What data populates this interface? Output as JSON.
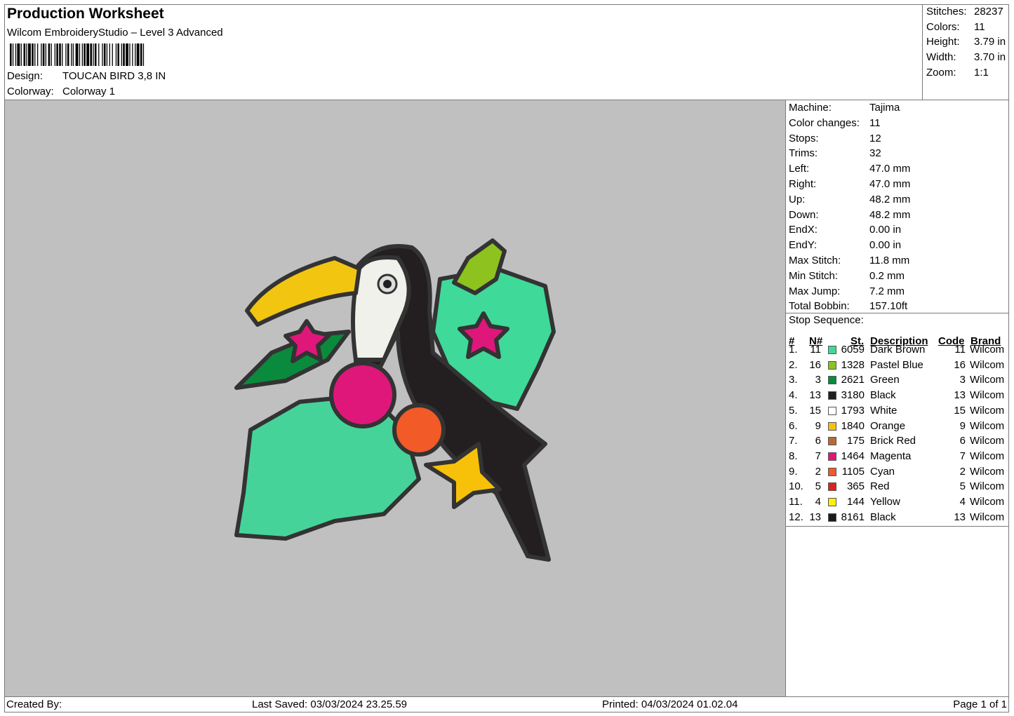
{
  "header": {
    "title": "Production Worksheet",
    "software": "Wilcom EmbroideryStudio – Level 3 Advanced",
    "design_label": "Design:",
    "design_value": "TOUCAN BIRD 3,8 IN",
    "colorway_label": "Colorway:",
    "colorway_value": "Colorway 1"
  },
  "stats": [
    {
      "label": "Stitches:",
      "value": "28237"
    },
    {
      "label": "Colors:",
      "value": "11"
    },
    {
      "label": "Height:",
      "value": "3.79 in"
    },
    {
      "label": "Width:",
      "value": "3.70 in"
    },
    {
      "label": "Zoom:",
      "value": "1:1"
    }
  ],
  "properties": [
    {
      "label": "Machine:",
      "value": "Tajima"
    },
    {
      "label": "Color changes:",
      "value": "11"
    },
    {
      "label": "Stops:",
      "value": "12"
    },
    {
      "label": "Trims:",
      "value": "32"
    },
    {
      "label": "Left:",
      "value": "47.0 mm"
    },
    {
      "label": "Right:",
      "value": "47.0 mm"
    },
    {
      "label": "Up:",
      "value": "48.2 mm"
    },
    {
      "label": "Down:",
      "value": "48.2 mm"
    },
    {
      "label": "EndX:",
      "value": "0.00 in"
    },
    {
      "label": "EndY:",
      "value": "0.00 in"
    },
    {
      "label": "Max Stitch:",
      "value": "11.8 mm"
    },
    {
      "label": "Min Stitch:",
      "value": "0.2 mm"
    },
    {
      "label": "Max Jump:",
      "value": "7.2 mm"
    },
    {
      "label": "Total Bobbin:",
      "value": "157.10ft"
    }
  ],
  "stop_sequence": {
    "title": "Stop Sequence:",
    "columns": {
      "num": "#",
      "needle": "N#",
      "stitches": "St.",
      "description": "Description",
      "code": "Code",
      "brand": "Brand"
    },
    "rows": [
      {
        "num": "1.",
        "needle": "11",
        "color": "#3fd99a",
        "stitches": "6059",
        "description": "Dark Brown",
        "code": "11",
        "brand": "Wilcom"
      },
      {
        "num": "2.",
        "needle": "16",
        "color": "#8dc21f",
        "stitches": "1328",
        "description": "Pastel Blue",
        "code": "16",
        "brand": "Wilcom"
      },
      {
        "num": "3.",
        "needle": "3",
        "color": "#0a8a3c",
        "stitches": "2621",
        "description": "Green",
        "code": "3",
        "brand": "Wilcom"
      },
      {
        "num": "4.",
        "needle": "13",
        "color": "#231f20",
        "stitches": "3180",
        "description": "Black",
        "code": "13",
        "brand": "Wilcom"
      },
      {
        "num": "5.",
        "needle": "15",
        "color": "#ffffff",
        "stitches": "1793",
        "description": "White",
        "code": "15",
        "brand": "Wilcom"
      },
      {
        "num": "6.",
        "needle": "9",
        "color": "#f7c10a",
        "stitches": "1840",
        "description": "Orange",
        "code": "9",
        "brand": "Wilcom"
      },
      {
        "num": "7.",
        "needle": "6",
        "color": "#b86a35",
        "stitches": "175",
        "description": "Brick Red",
        "code": "6",
        "brand": "Wilcom"
      },
      {
        "num": "8.",
        "needle": "7",
        "color": "#e0177b",
        "stitches": "1464",
        "description": "Magenta",
        "code": "7",
        "brand": "Wilcom"
      },
      {
        "num": "9.",
        "needle": "2",
        "color": "#f25a28",
        "stitches": "1105",
        "description": "Cyan",
        "code": "2",
        "brand": "Wilcom"
      },
      {
        "num": "10.",
        "needle": "5",
        "color": "#e0201b",
        "stitches": "365",
        "description": "Red",
        "code": "5",
        "brand": "Wilcom"
      },
      {
        "num": "11.",
        "needle": "4",
        "color": "#fff200",
        "stitches": "144",
        "description": "Yellow",
        "code": "4",
        "brand": "Wilcom"
      },
      {
        "num": "12.",
        "needle": "13",
        "color": "#1a1a1a",
        "stitches": "8161",
        "description": "Black",
        "code": "13",
        "brand": "Wilcom"
      }
    ]
  },
  "footer": {
    "created_by": "Created By:",
    "last_saved": "Last Saved: 03/03/2024 23.25.59",
    "printed": "Printed: 04/03/2024 01.02.04",
    "page": "Page 1 of 1"
  }
}
